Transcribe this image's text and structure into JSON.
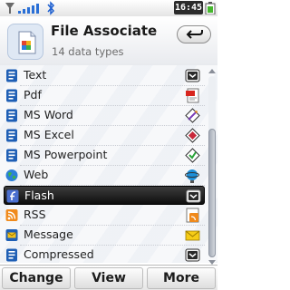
{
  "status_bar": {
    "time": "16:45"
  },
  "header": {
    "title": "File Associate",
    "subtitle": "14 data types",
    "back_icon": "return-arrow-icon"
  },
  "list": {
    "selected_index": 6,
    "items": [
      {
        "label": "Text",
        "icon": "text-document-icon",
        "app": "text-viewer-icon"
      },
      {
        "label": "Pdf",
        "icon": "text-document-icon",
        "app": "pdf-reader-icon"
      },
      {
        "label": "MS Word",
        "icon": "text-document-icon",
        "app": "office-doc-icon"
      },
      {
        "label": "MS Excel",
        "icon": "text-document-icon",
        "app": "office-sheet-icon"
      },
      {
        "label": "MS Powerpoint",
        "icon": "text-document-icon",
        "app": "office-slides-icon"
      },
      {
        "label": "Web",
        "icon": "globe-icon",
        "app": "browser-icon"
      },
      {
        "label": "Flash",
        "icon": "flash-icon",
        "app": "flash-player-icon"
      },
      {
        "label": "RSS",
        "icon": "rss-icon",
        "app": "rss-reader-icon"
      },
      {
        "label": "Message",
        "icon": "envelope-icon",
        "app": "mail-icon"
      },
      {
        "label": "Compressed",
        "icon": "text-document-icon",
        "app": "archive-viewer-icon"
      }
    ]
  },
  "softkeys": {
    "left": "Change",
    "center": "View",
    "right": "More"
  },
  "colors": {
    "selection": "#1a1a1a",
    "doc_icon": "#1f5fb5"
  }
}
